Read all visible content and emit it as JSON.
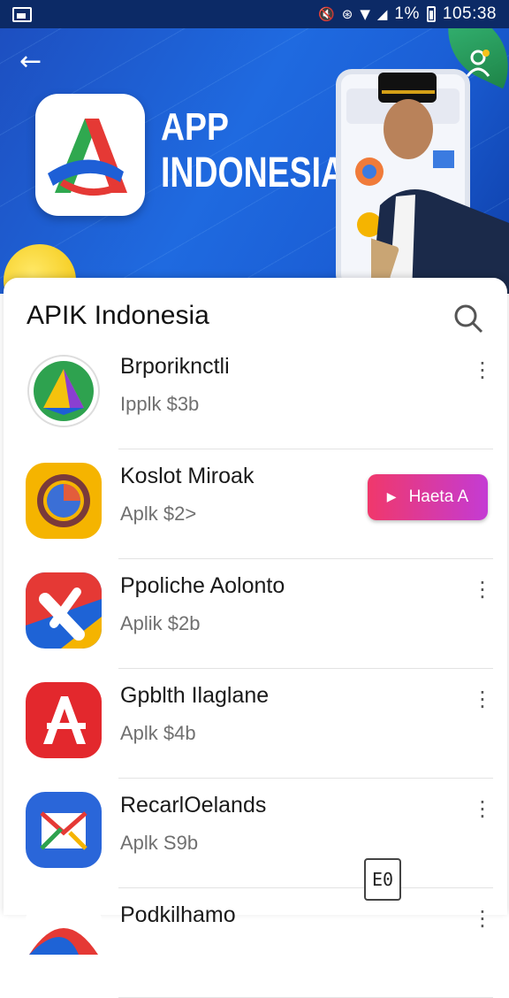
{
  "status_bar": {
    "icons": [
      "screenshot-icon",
      "mute-icon",
      "hotspot-icon",
      "wifi-icon",
      "signal-icon",
      "battery-icon"
    ],
    "battery_text": "1%",
    "time": "105:38"
  },
  "banner": {
    "title_line1": "APP",
    "title_line2": "INDONESIA",
    "icons": [
      "back-arrow-icon",
      "profile-icon"
    ],
    "colors": {
      "background": "#1d5fd6",
      "accent": "#f2c40a"
    }
  },
  "sheet": {
    "title": "APIK Indonesia",
    "search_icon": "search-icon"
  },
  "apps": [
    {
      "name": "Brporiknctli",
      "sub": "Ipplk $3b",
      "action": "more"
    },
    {
      "name": "Koslot Miroak",
      "sub": "Aplk $2>",
      "action": "button",
      "button_label": "Haeta A"
    },
    {
      "name": "Ppoliche Aolonto",
      "sub": "Aplik $2b",
      "action": "more"
    },
    {
      "name": "Gpblth Ilaglane",
      "sub": "Aplk $4b",
      "action": "more"
    },
    {
      "name": "RecarlOelands",
      "sub": "Aplk S9b",
      "action": "more"
    },
    {
      "name": "Podkilhamo",
      "sub": "",
      "action": "more"
    }
  ],
  "more_glyph": "⋮",
  "floating_doc_label": "E0"
}
